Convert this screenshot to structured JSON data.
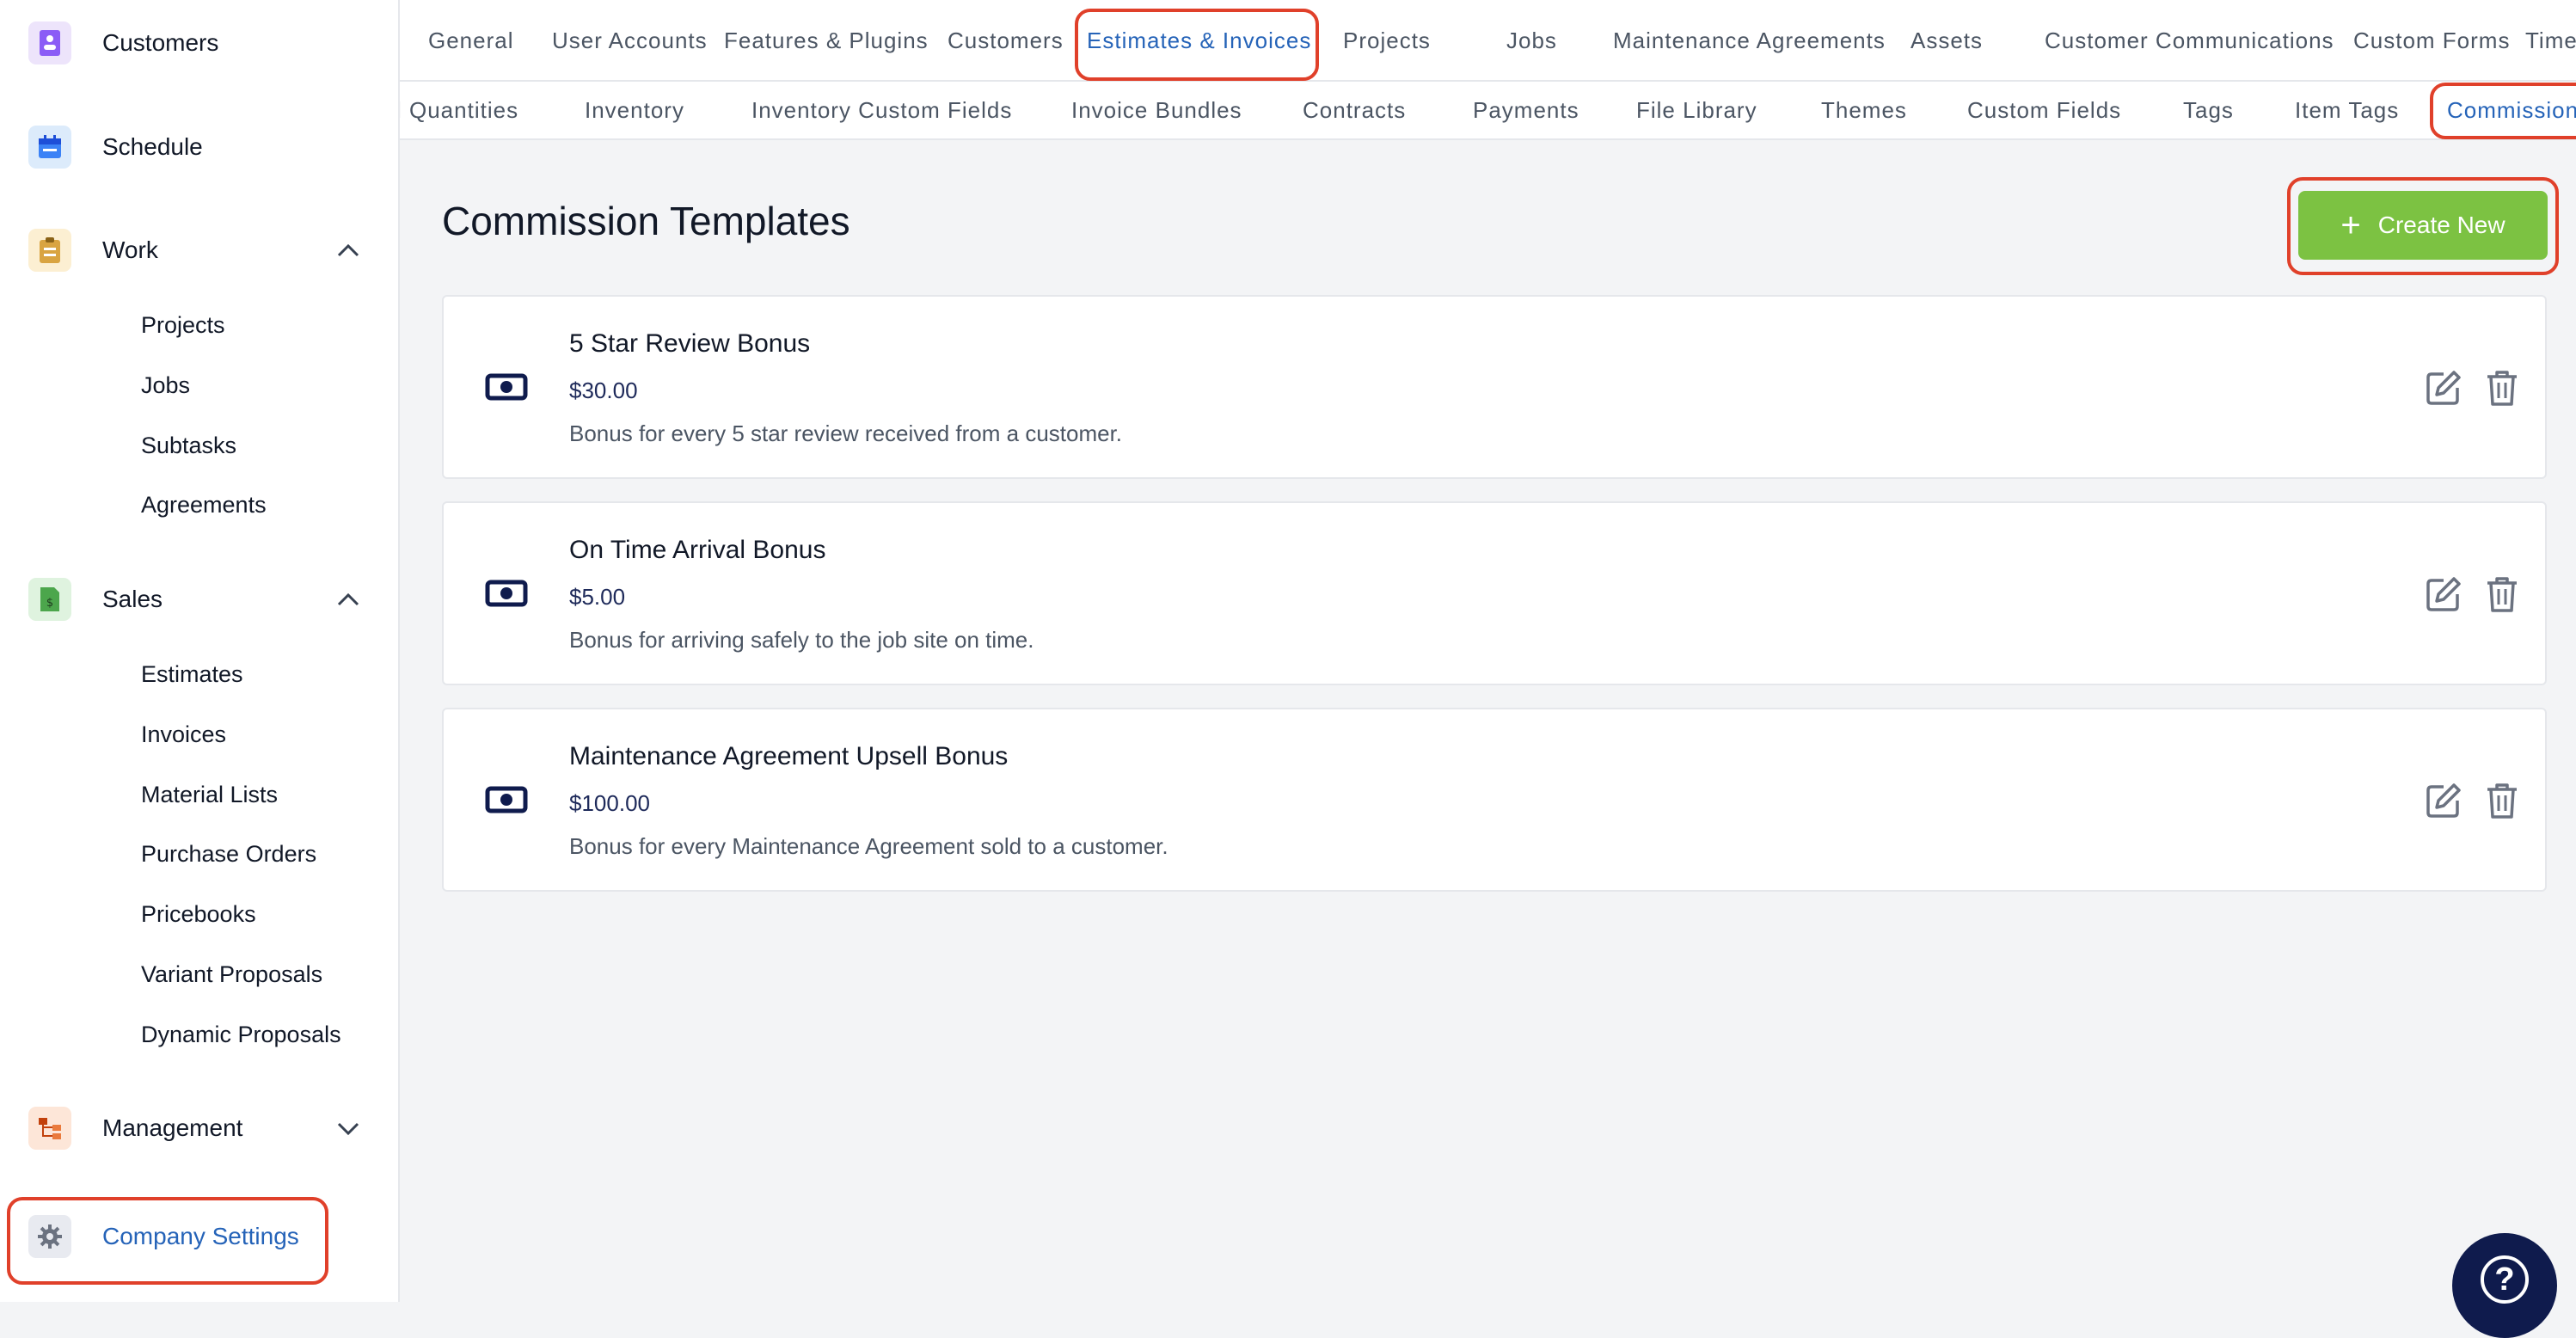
{
  "sidebar": {
    "items": [
      {
        "label": "Customers",
        "icon": "customers-icon"
      },
      {
        "label": "Schedule",
        "icon": "calendar-icon"
      },
      {
        "label": "Work",
        "icon": "clipboard-icon",
        "expanded": true,
        "children": [
          "Projects",
          "Jobs",
          "Subtasks",
          "Agreements"
        ]
      },
      {
        "label": "Sales",
        "icon": "invoice-icon",
        "expanded": true,
        "children": [
          "Estimates",
          "Invoices",
          "Material Lists",
          "Purchase Orders",
          "Pricebooks",
          "Variant Proposals",
          "Dynamic Proposals"
        ]
      },
      {
        "label": "Management",
        "icon": "org-chart-icon",
        "expanded": false
      },
      {
        "label": "Company Settings",
        "icon": "gear-icon",
        "active": true
      }
    ]
  },
  "tabs_primary": [
    "General",
    "User Accounts",
    "Features & Plugins",
    "Customers",
    "Estimates & Invoices",
    "Projects",
    "Jobs",
    "Maintenance Agreements",
    "Assets",
    "Customer Communications",
    "Custom Forms",
    "Time"
  ],
  "tabs_primary_active": "Estimates & Invoices",
  "tabs_secondary": [
    "l Quantities",
    "Inventory",
    "Inventory Custom Fields",
    "Invoice Bundles",
    "Contracts",
    "Payments",
    "File Library",
    "Themes",
    "Custom Fields",
    "Tags",
    "Item Tags",
    "Commission"
  ],
  "tabs_secondary_active": "Commission",
  "main": {
    "title": "Commission Templates",
    "create_label": "Create New",
    "templates": [
      {
        "name": "5 Star Review Bonus",
        "amount": "$30.00",
        "description": "Bonus for every 5 star review received from a customer."
      },
      {
        "name": "On Time Arrival Bonus",
        "amount": "$5.00",
        "description": "Bonus for arriving safely to the job site on time."
      },
      {
        "name": "Maintenance Agreement Upsell Bonus",
        "amount": "$100.00",
        "description": "Bonus for every Maintenance Agreement sold to a customer."
      }
    ]
  },
  "help_label": "?",
  "colors": {
    "accent": "#2563b8",
    "create_button": "#7cc242",
    "highlight": "#e0402a",
    "help_button": "#0f1b4d"
  }
}
